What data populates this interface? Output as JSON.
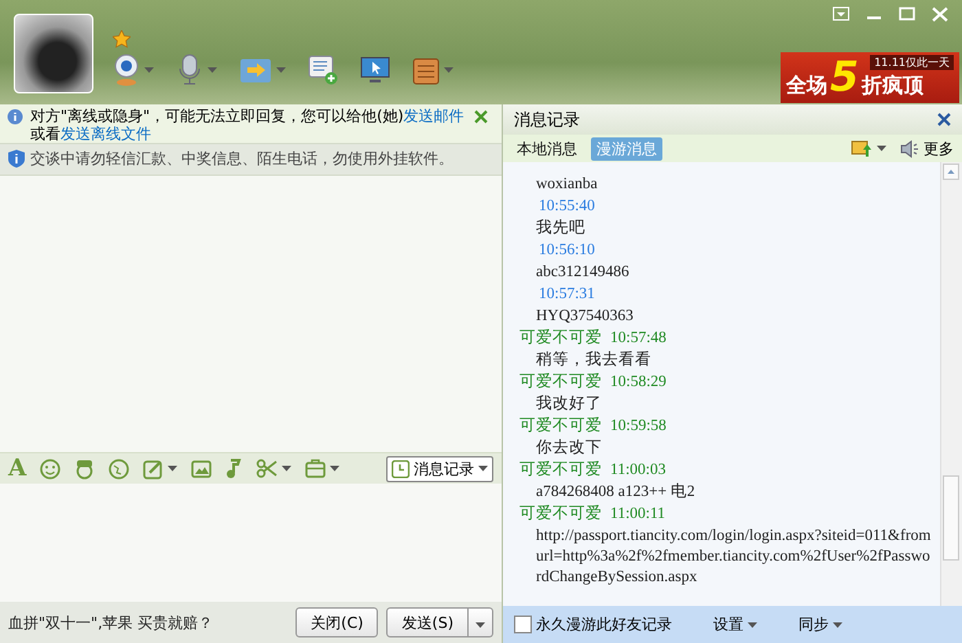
{
  "banner": {
    "tag": "11.11仅此一天",
    "lead": "全场",
    "number": "5",
    "tail": "折疯顶"
  },
  "notice": {
    "text": "对方\"离线或隐身\"，可能无法立即回复，您可以给他(她)",
    "link1": "发送邮件",
    "middle": "或看",
    "link2": "发送离线文件"
  },
  "security": "交谈中请勿轻信汇款、中奖信息、陌生电话，勿使用外挂软件。",
  "format_toolbar": {
    "font_label": "A",
    "history_button": "消息记录"
  },
  "ad_text": "血拼\"双十一\",苹果 买贵就赔？",
  "buttons": {
    "close": "关闭(C)",
    "send": "发送(S)"
  },
  "history": {
    "title": "消息记录",
    "tabs": [
      {
        "label": "本地消息",
        "selected": false
      },
      {
        "label": "漫游消息",
        "selected": true
      }
    ],
    "more": "更多",
    "items": [
      {
        "kind": "text",
        "text": "woxianba"
      },
      {
        "kind": "time",
        "time": "10:55:40"
      },
      {
        "kind": "text",
        "text": "我先吧"
      },
      {
        "kind": "time",
        "time": "10:56:10"
      },
      {
        "kind": "text",
        "text": "abc312149486"
      },
      {
        "kind": "time",
        "time": "10:57:31"
      },
      {
        "kind": "text",
        "text": "HYQ37540363"
      },
      {
        "kind": "sender",
        "name": "可爱不可爱",
        "time": "10:57:48"
      },
      {
        "kind": "text",
        "text": "稍等，我去看看"
      },
      {
        "kind": "sender",
        "name": "可爱不可爱",
        "time": "10:58:29"
      },
      {
        "kind": "text",
        "text": "我改好了"
      },
      {
        "kind": "sender",
        "name": "可爱不可爱",
        "time": "10:59:58"
      },
      {
        "kind": "text",
        "text": "你去改下"
      },
      {
        "kind": "sender",
        "name": "可爱不可爱",
        "time": "11:00:03"
      },
      {
        "kind": "text",
        "text": "a784268408 a123++ 电2"
      },
      {
        "kind": "sender",
        "name": "可爱不可爱",
        "time": "11:00:11"
      },
      {
        "kind": "text",
        "text": "http://passport.tiancity.com/login/login.aspx?siteid=011&fromurl=http%3a%2f%2fmember.tiancity.com%2fUser%2fPasswordChangeBySession.aspx"
      }
    ],
    "footer": {
      "roam_label": "永久漫游此好友记录",
      "roam_checked": false,
      "settings": "设置",
      "sync": "同步"
    }
  }
}
